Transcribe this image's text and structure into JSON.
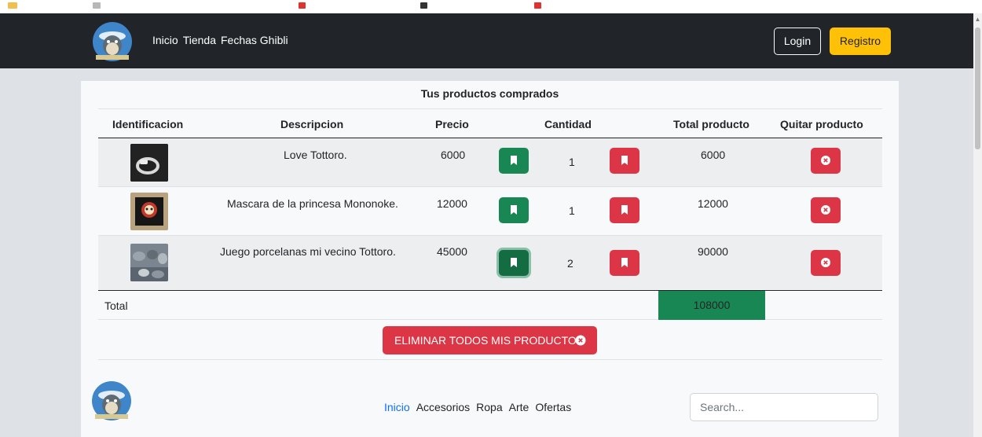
{
  "navbar": {
    "links": [
      "Inicio",
      "Tienda",
      "Fechas Ghibli"
    ],
    "login_label": "Login",
    "registro_label": "Registro",
    "background": "#212529"
  },
  "cart": {
    "caption": "Tus productos comprados",
    "headers": {
      "id": "Identificacion",
      "description": "Descripcion",
      "price": "Precio",
      "quantity": "Cantidad",
      "total": "Total producto",
      "remove": "Quitar producto"
    },
    "items": [
      {
        "image": "ring-thumbnail",
        "description": "Love Tottoro.",
        "price": "6000",
        "quantity": "1",
        "total": "6000"
      },
      {
        "image": "mask-thumbnail",
        "description": "Mascara de la princesa Mononoke.",
        "price": "12000",
        "quantity": "1",
        "total": "12000"
      },
      {
        "image": "porcelain-thumbnail",
        "description": "Juego porcelanas mi vecino Tottoro.",
        "price": "45000",
        "quantity": "2",
        "total": "90000"
      }
    ],
    "total_label": "Total",
    "total_value": "108000",
    "delete_all_label": "ELIMINAR TODOS MIS PRODUCTOS"
  },
  "footer": {
    "links": [
      "Inicio",
      "Accesorios",
      "Ropa",
      "Arte",
      "Ofertas"
    ],
    "active_link": "Inicio",
    "search_placeholder": "Search..."
  },
  "icons": {
    "increase": "bookmark-icon",
    "decrease": "bookmark-icon",
    "remove": "x-circle-icon",
    "logo": "totoro-logo"
  },
  "colors": {
    "success": "#198754",
    "danger": "#dc3545",
    "warning": "#ffc107",
    "link_active": "#0d6efd"
  }
}
